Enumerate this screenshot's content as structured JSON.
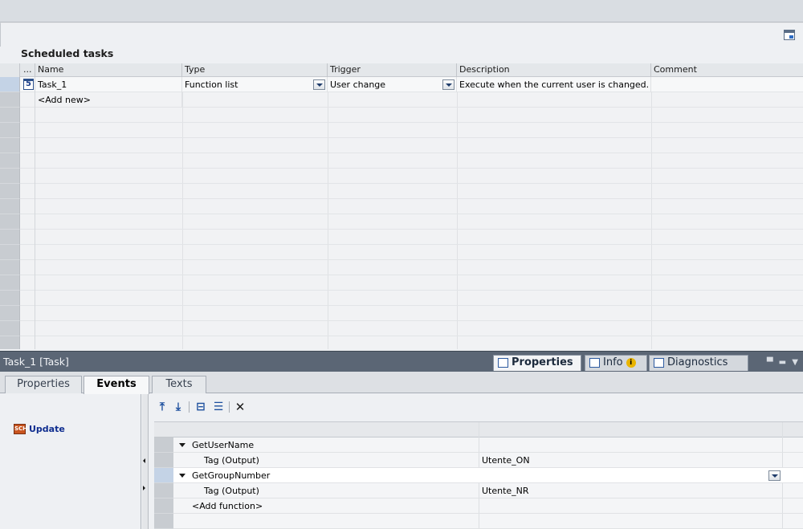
{
  "editor": {
    "section_title": "Scheduled tasks",
    "columns": {
      "dots": "...",
      "name": "Name",
      "type": "Type",
      "trigger": "Trigger",
      "description": "Description",
      "comment": "Comment"
    },
    "rows": [
      {
        "icon_text": "5",
        "name": "Task_1",
        "type": "Function list",
        "trigger": "User change",
        "description": "Execute when the current user is changed.",
        "comment": ""
      }
    ],
    "add_new": "<Add new>"
  },
  "inspector": {
    "object_title": "Task_1 [Task]",
    "main_tabs": [
      {
        "label": "Properties",
        "icon": "properties-icon"
      },
      {
        "label": "Info",
        "icon": "info-icon"
      },
      {
        "label": "Diagnostics",
        "icon": "diagnostics-icon"
      }
    ],
    "info_badge": "i",
    "sub_tabs": [
      "Properties",
      "Events",
      "Texts"
    ],
    "events": [
      {
        "label": "Update",
        "icon_text": "SCH"
      }
    ],
    "function_list": [
      {
        "kind": "function",
        "text": "GetUserName",
        "value": ""
      },
      {
        "kind": "param",
        "text": "Tag (Output)",
        "value": "Utente_ON"
      },
      {
        "kind": "function",
        "text": "GetGroupNumber",
        "value": ""
      },
      {
        "kind": "param",
        "text": "Tag (Output)",
        "value": "Utente_NR"
      },
      {
        "kind": "add",
        "text": "<Add function>",
        "value": ""
      }
    ]
  },
  "colors": {
    "accent": "#1d4f9e",
    "inspector_bar": "#5b6675",
    "row_header": "#c8ccd1"
  }
}
